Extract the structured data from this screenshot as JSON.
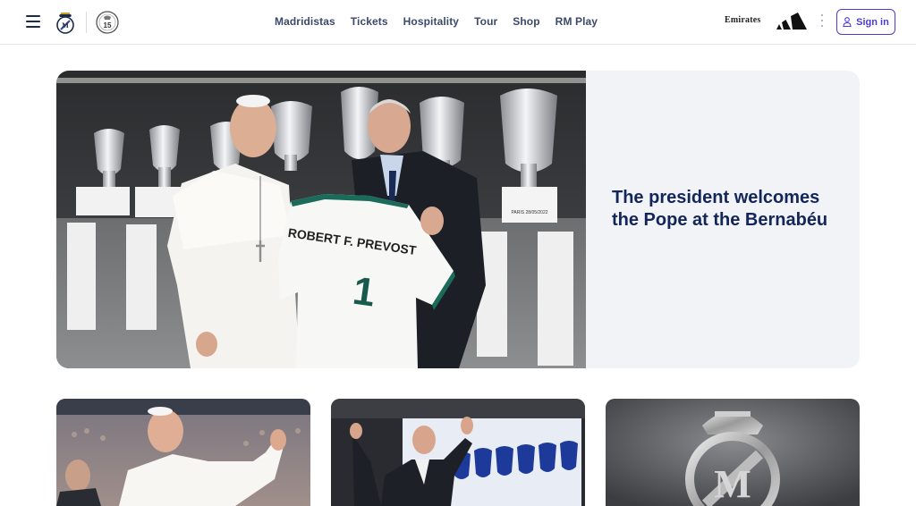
{
  "header": {
    "nav": [
      "Madridistas",
      "Tickets",
      "Hospitality",
      "Tour",
      "Shop",
      "RM Play"
    ],
    "sponsor": "Emirates",
    "signin_label": "Sign in",
    "badge_number": "15",
    "icons": {
      "menu": "hamburger-icon",
      "crest": "real-madrid-crest",
      "badge": "fifteen-trophies-badge",
      "brand": "adidas-logo",
      "more": "kebab-menu-icon",
      "user": "user-icon"
    }
  },
  "hero": {
    "title": "The president welcomes the Pope at the Bernabéu",
    "jersey_name": "ROBERT F. PREVOST",
    "jersey_number": "1",
    "plaque_text": "PARIS 28/05/2022"
  },
  "cards": [
    {
      "image": "pope-waving-in-stadium"
    },
    {
      "image": "president-waving-with-trophies"
    },
    {
      "image": "real-madrid-crest-3d"
    }
  ],
  "colors": {
    "accent": "#4b3bd6",
    "title": "#13265a",
    "nav_text": "#3a4a6b",
    "hero_panel": "#f2f3f7"
  }
}
